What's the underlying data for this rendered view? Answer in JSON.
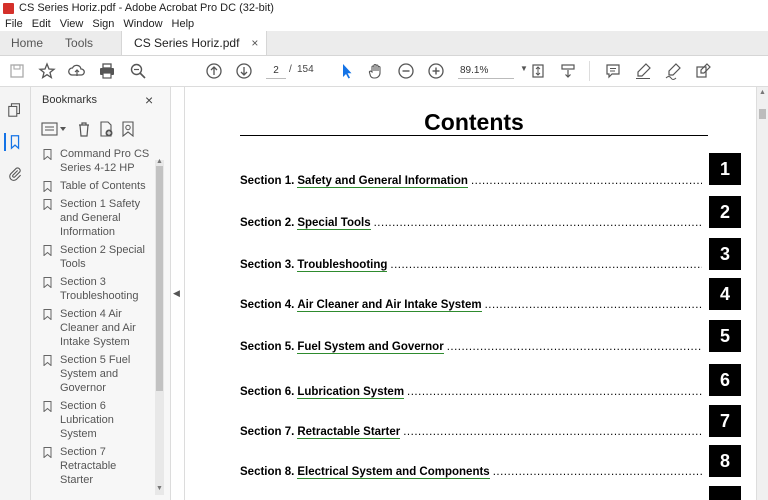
{
  "window": {
    "title": "CS Series Horiz.pdf - Adobe Acrobat Pro DC (32-bit)"
  },
  "menu": [
    "File",
    "Edit",
    "View",
    "Sign",
    "Window",
    "Help"
  ],
  "tabs": {
    "home": "Home",
    "tools": "Tools",
    "document": "CS Series Horiz.pdf",
    "close_glyph": "×"
  },
  "toolbar": {
    "page_current": "2",
    "page_separator": "/",
    "page_total": "154",
    "zoom": "89.1%"
  },
  "bookmarks": {
    "header": "Bookmarks",
    "close_glyph": "×",
    "items": [
      "Command Pro CS Series 4-12 HP",
      "Table of Contents",
      "Section 1 Safety and General Information",
      "Section 2 Special Tools",
      "Section 3 Troubleshooting",
      "Section 4 Air Cleaner and Air Intake System",
      "Section 5 Fuel System and Governor",
      "Section 6 Lubrication System",
      "Section 7 Retractable Starter"
    ]
  },
  "document": {
    "title": "Contents",
    "toc": [
      {
        "section": "Section 1.",
        "title": "Safety and General Information",
        "number": "1"
      },
      {
        "section": "Section 2.",
        "title": "Special Tools",
        "number": "2"
      },
      {
        "section": "Section 3.",
        "title": "Troubleshooting",
        "number": "3"
      },
      {
        "section": "Section 4.",
        "title": "Air Cleaner and Air Intake System",
        "number": "4"
      },
      {
        "section": "Section 5.",
        "title": "Fuel System and Governor",
        "number": "5"
      },
      {
        "section": "Section 6.",
        "title": "Lubrication System",
        "number": "6"
      },
      {
        "section": "Section 7.",
        "title": "Retractable Starter",
        "number": "7"
      },
      {
        "section": "Section 8.",
        "title": "Electrical System and Components",
        "number": "8"
      }
    ],
    "leader": "......................................................................................................................................................"
  },
  "colors": {
    "accent": "#1473e6",
    "link_underline": "#2e8b2e",
    "pdf_red": "#d4302a"
  }
}
